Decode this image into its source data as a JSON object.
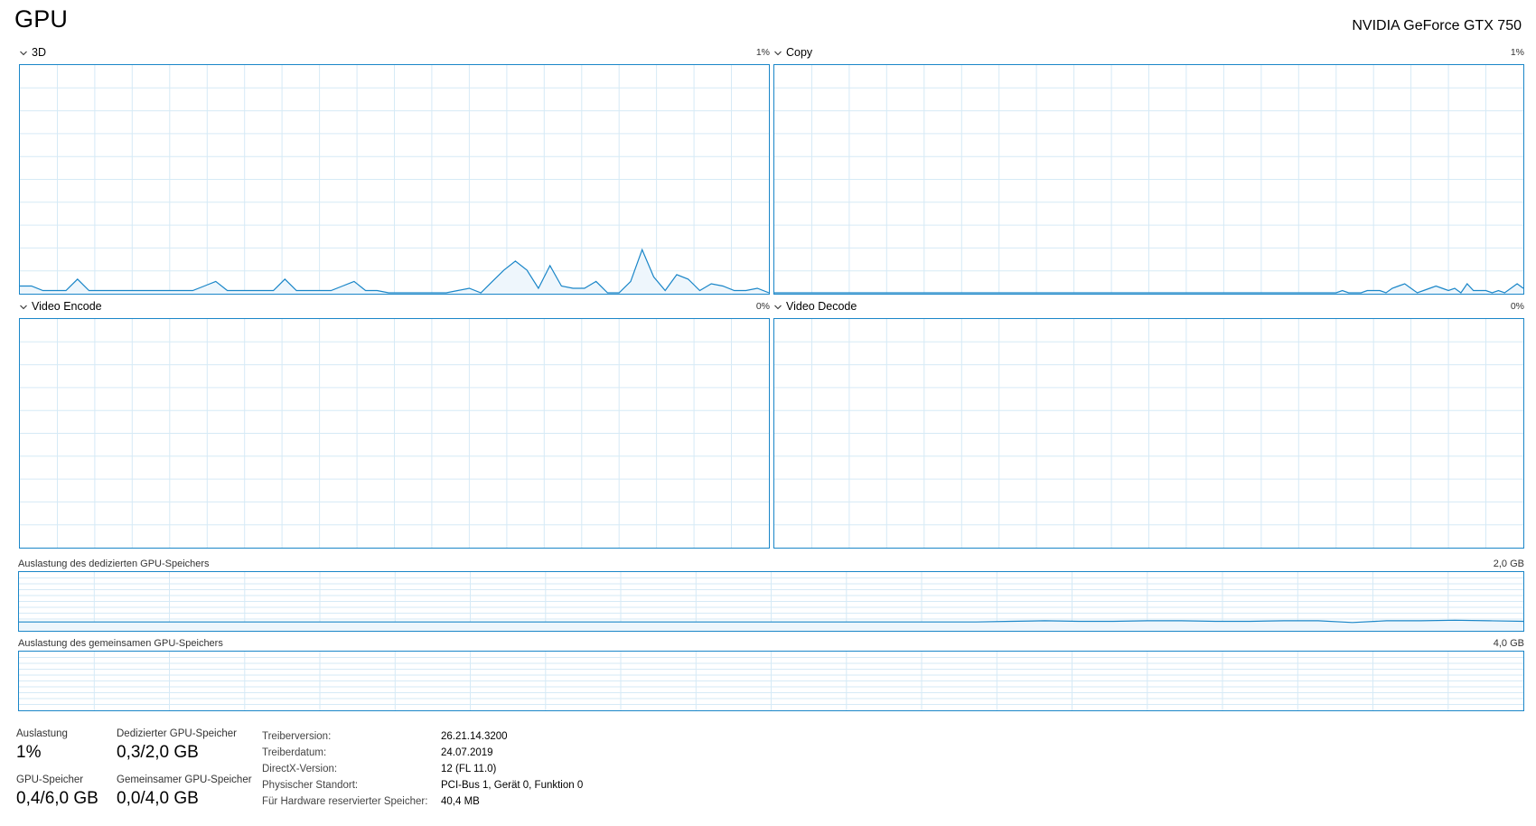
{
  "header": {
    "title": "GPU",
    "device_name": "NVIDIA GeForce GTX 750"
  },
  "colors": {
    "accent": "#1a86c8",
    "grid": "#d6eaf6",
    "fill": "#eef6fc"
  },
  "graphs": [
    {
      "name": "3D",
      "max_label": "1%",
      "values": [
        3,
        3,
        1,
        1,
        1,
        6,
        1,
        1,
        1,
        1,
        1,
        1,
        1,
        1,
        1,
        1,
        3,
        5,
        1,
        1,
        1,
        1,
        1,
        6,
        1,
        1,
        1,
        1,
        3,
        5,
        1,
        1,
        0,
        0,
        0,
        0,
        0,
        0,
        1,
        2,
        0,
        5,
        10,
        14,
        10,
        2,
        12,
        3,
        2,
        2,
        5,
        0,
        0,
        5,
        19,
        7,
        1,
        8,
        6,
        1,
        4,
        3,
        1,
        1,
        2,
        0
      ]
    },
    {
      "name": "Copy",
      "max_label": "1%",
      "values": [
        0,
        0,
        0,
        0,
        0,
        0,
        0,
        0,
        0,
        0,
        0,
        0,
        0,
        0,
        0,
        0,
        0,
        0,
        0,
        0,
        0,
        0,
        0,
        0,
        0,
        0,
        0,
        0,
        0,
        0,
        0,
        0,
        0,
        0,
        0,
        0,
        0,
        0,
        0,
        0,
        0,
        0,
        0,
        0,
        0,
        0,
        0,
        0,
        0,
        0,
        0,
        0,
        0,
        0,
        0,
        0,
        0,
        0,
        0,
        0,
        0,
        0,
        0,
        0,
        0,
        0,
        0,
        0,
        0,
        0,
        0,
        0,
        0,
        0,
        0,
        0,
        0,
        0,
        0,
        0,
        0,
        0,
        0,
        0,
        0,
        0,
        0,
        0,
        0,
        0,
        0,
        1,
        0,
        0,
        0,
        1,
        1,
        1,
        0,
        2,
        3,
        4,
        2,
        0,
        1,
        2,
        3,
        2,
        1,
        2,
        0,
        4,
        1,
        1,
        1,
        0,
        1,
        0,
        2,
        4,
        2
      ]
    },
    {
      "name": "Video Encode",
      "max_label": "0%",
      "values": []
    },
    {
      "name": "Video Decode",
      "max_label": "0%",
      "values": []
    }
  ],
  "memory_graphs": [
    {
      "label": "Auslastung des dedizierten GPU-Speichers",
      "max_label": "2,0 GB",
      "values": [
        0.14,
        0.14,
        0.14,
        0.14,
        0.14,
        0.14,
        0.14,
        0.14,
        0.14,
        0.14,
        0.14,
        0.14,
        0.14,
        0.14,
        0.14,
        0.14,
        0.14,
        0.14,
        0.14,
        0.14,
        0.14,
        0.14,
        0.14,
        0.14,
        0.14,
        0.14,
        0.14,
        0.14,
        0.14,
        0.15,
        0.16,
        0.15,
        0.15,
        0.16,
        0.16,
        0.15,
        0.15,
        0.16,
        0.16,
        0.13,
        0.16,
        0.16,
        0.17,
        0.16,
        0.15
      ]
    },
    {
      "label": "Auslastung des gemeinsamen GPU-Speichers",
      "max_label": "4,0 GB",
      "values": []
    }
  ],
  "stats": {
    "auslastung_label": "Auslastung",
    "auslastung_value": "1%",
    "dedicated_label": "Dedizierter GPU-Speicher",
    "dedicated_value": "0,3/2,0 GB",
    "gpu_mem_label": "GPU-Speicher",
    "gpu_mem_value": "0,4/6,0 GB",
    "shared_label": "Gemeinsamer GPU-Speicher",
    "shared_value": "0,0/4,0 GB"
  },
  "properties": [
    {
      "key": "Treiberversion:",
      "value": "26.21.14.3200"
    },
    {
      "key": "Treiberdatum:",
      "value": "24.07.2019"
    },
    {
      "key": "DirectX-Version:",
      "value": "12 (FL 11.0)"
    },
    {
      "key": "Physischer Standort:",
      "value": "PCI-Bus 1, Gerät 0, Funktion 0"
    },
    {
      "key": "Für Hardware reservierter Speicher:",
      "value": "40,4 MB"
    }
  ]
}
